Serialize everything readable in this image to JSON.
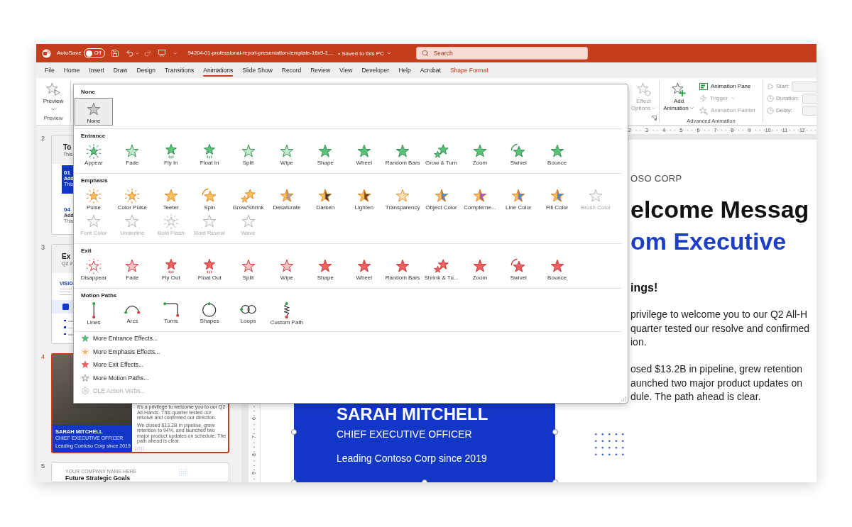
{
  "title_bar": {
    "autosave_label": "AutoSave",
    "autosave": {
      "label": "Off",
      "on": false
    },
    "file_name": "94204-01-professional-report-presentation-template-16x9-1....",
    "save_status": "• Saved to this PC",
    "search": {
      "placeholder": "Search"
    }
  },
  "tabs": [
    {
      "label": "File",
      "selected": false,
      "contextual": false
    },
    {
      "label": "Home",
      "selected": false,
      "contextual": false
    },
    {
      "label": "Insert",
      "selected": false,
      "contextual": false
    },
    {
      "label": "Draw",
      "selected": false,
      "contextual": false
    },
    {
      "label": "Design",
      "selected": false,
      "contextual": false
    },
    {
      "label": "Transitions",
      "selected": false,
      "contextual": false
    },
    {
      "label": "Animations",
      "selected": true,
      "contextual": false
    },
    {
      "label": "Slide Show",
      "selected": false,
      "contextual": false
    },
    {
      "label": "Record",
      "selected": false,
      "contextual": false
    },
    {
      "label": "Review",
      "selected": false,
      "contextual": false
    },
    {
      "label": "View",
      "selected": false,
      "contextual": false
    },
    {
      "label": "Developer",
      "selected": false,
      "contextual": false
    },
    {
      "label": "Help",
      "selected": false,
      "contextual": false
    },
    {
      "label": "Acrobat",
      "selected": false,
      "contextual": false
    },
    {
      "label": "Shape Format",
      "selected": false,
      "contextual": true
    }
  ],
  "ribbon": {
    "preview": {
      "label": "Preview",
      "group": "Preview"
    },
    "effect_options": {
      "label": "Effect Options",
      "disabled": true
    },
    "advanced_animation": {
      "add": {
        "label": "Add Animation"
      },
      "commands": [
        {
          "label": "Animation Pane",
          "kind": "pane",
          "disabled": false
        },
        {
          "label": "Trigger",
          "kind": "trigger",
          "disabled": true
        },
        {
          "label": "Animation Painter",
          "kind": "painter",
          "disabled": true
        }
      ],
      "group": "Advanced Animation"
    },
    "timing": [
      {
        "label": "Start:",
        "kind": "start",
        "disabled": true
      },
      {
        "label": "Duration:",
        "kind": "duration",
        "disabled": true
      },
      {
        "label": "Delay:",
        "kind": "delay",
        "disabled": true
      }
    ]
  },
  "animation_gallery": {
    "sections": [
      {
        "title": "None",
        "kind": "none",
        "items": [
          {
            "label": "None",
            "selected": true
          }
        ]
      },
      {
        "title": "Entrance",
        "kind": "entrance",
        "items": [
          {
            "label": "Appear",
            "selected": false
          },
          {
            "label": "Fade",
            "selected": false
          },
          {
            "label": "Fly In",
            "selected": false
          },
          {
            "label": "Float In",
            "selected": false
          },
          {
            "label": "Split",
            "selected": false
          },
          {
            "label": "Wipe",
            "selected": false
          },
          {
            "label": "Shape",
            "selected": false
          },
          {
            "label": "Wheel",
            "selected": false
          },
          {
            "label": "Random Bars",
            "selected": false
          },
          {
            "label": "Grow & Turn",
            "selected": false
          },
          {
            "label": "Zoom",
            "selected": false
          },
          {
            "label": "Swivel",
            "selected": false
          },
          {
            "label": "Bounce",
            "selected": false
          }
        ]
      },
      {
        "title": "Emphasis",
        "kind": "emphasis",
        "items": [
          {
            "label": "Pulse",
            "selected": false,
            "disabled": false
          },
          {
            "label": "Color Pulse",
            "selected": false,
            "disabled": false
          },
          {
            "label": "Teeter",
            "selected": false,
            "disabled": false
          },
          {
            "label": "Spin",
            "selected": false,
            "disabled": false
          },
          {
            "label": "Grow/Shrink",
            "selected": false,
            "disabled": false
          },
          {
            "label": "Desaturate",
            "selected": false,
            "disabled": false
          },
          {
            "label": "Darken",
            "selected": false,
            "disabled": false
          },
          {
            "label": "Lighten",
            "selected": false,
            "disabled": false
          },
          {
            "label": "Transparency",
            "selected": false,
            "disabled": false
          },
          {
            "label": "Object Color",
            "selected": false,
            "disabled": false
          },
          {
            "label": "Compleme...",
            "selected": false,
            "disabled": false
          },
          {
            "label": "Line Color",
            "selected": false,
            "disabled": false
          },
          {
            "label": "Fill Color",
            "selected": false,
            "disabled": false
          },
          {
            "label": "Brush Color",
            "selected": false,
            "disabled": true
          },
          {
            "label": "Font Color",
            "selected": false,
            "disabled": true
          },
          {
            "label": "Underline",
            "selected": false,
            "disabled": true
          },
          {
            "label": "Bold Flash",
            "selected": false,
            "disabled": true
          },
          {
            "label": "Bold Reveal",
            "selected": false,
            "disabled": true
          },
          {
            "label": "Wave",
            "selected": false,
            "disabled": true
          }
        ]
      },
      {
        "title": "Exit",
        "kind": "exit",
        "items": [
          {
            "label": "Disappear",
            "selected": false
          },
          {
            "label": "Fade",
            "selected": false
          },
          {
            "label": "Fly Out",
            "selected": false
          },
          {
            "label": "Float Out",
            "selected": false
          },
          {
            "label": "Split",
            "selected": false
          },
          {
            "label": "Wipe",
            "selected": false
          },
          {
            "label": "Shape",
            "selected": false
          },
          {
            "label": "Wheel",
            "selected": false
          },
          {
            "label": "Random Bars",
            "selected": false
          },
          {
            "label": "Shrink & Tu...",
            "selected": false
          },
          {
            "label": "Zoom",
            "selected": false
          },
          {
            "label": "Swivel",
            "selected": false
          },
          {
            "label": "Bounce",
            "selected": false
          }
        ]
      },
      {
        "title": "Motion Paths",
        "kind": "motion",
        "items": [
          {
            "label": "Lines",
            "kind": "line",
            "selected": false
          },
          {
            "label": "Arcs",
            "kind": "arc",
            "selected": false
          },
          {
            "label": "Turns",
            "kind": "turn",
            "selected": false
          },
          {
            "label": "Shapes",
            "kind": "shape",
            "selected": false
          },
          {
            "label": "Loops",
            "kind": "loop",
            "selected": false
          },
          {
            "label": "Custom Path",
            "kind": "custom",
            "selected": false
          }
        ]
      }
    ],
    "more": [
      {
        "label": "More Entrance Effects...",
        "kind": "entrance",
        "disabled": false
      },
      {
        "label": "More Emphasis Effects...",
        "kind": "emphasis",
        "disabled": false
      },
      {
        "label": "More Exit Effects...",
        "kind": "exit",
        "disabled": false
      },
      {
        "label": "More Motion Paths...",
        "kind": "motion",
        "disabled": false
      },
      {
        "label": "OLE Action Verbs...",
        "kind": "verbs",
        "disabled": true
      }
    ]
  },
  "thumbnails": [
    {
      "number": "2",
      "selected": false,
      "kind": "agenda",
      "title": "To",
      "subtitle": "This",
      "items": [
        {
          "number": "01",
          "label": "Add",
          "text": "This",
          "highlighted": true
        },
        {
          "number": "04",
          "label": "Add",
          "text": "This",
          "highlighted": false
        }
      ]
    },
    {
      "number": "3",
      "selected": false,
      "kind": "executive",
      "title": "Ex",
      "subtitle": "Q2 2",
      "label": "VISIO"
    },
    {
      "number": "4",
      "selected": true,
      "kind": "welcome",
      "name": "SARAH MITCHELL",
      "role": "CHIEF EXECUTIVE OFFICER",
      "tagline": "Leading Contoso Corp since 2019",
      "paragraphs": [
        "It's a privilege to welcome you to our Q2 All-Hands. This quarter tested our resolve and confirmed our direction.",
        "We closed $13.2B in pipeline, grew retention to 94%, and launched two major product updates on schedule. The path ahead is clear."
      ]
    },
    {
      "number": "5",
      "selected": false,
      "kind": "goals",
      "eyebrow": "YOUR COMPANY NAME HERE",
      "title": "Future Strategic Goals"
    }
  ],
  "ruler": {
    "horizontal": [
      "2",
      "3",
      "4",
      "5",
      "6",
      "7",
      "8",
      "9",
      "10",
      "11",
      "12"
    ],
    "vertical": [
      "6",
      "7",
      "8",
      "9"
    ]
  },
  "slide": {
    "company": "OSO CORP",
    "heading": "elcome Messag",
    "subheading": "om Executive",
    "greeting": "ings!",
    "paragraphs": [
      [
        "privilege to welcome you to our Q2 All-H",
        "quarter tested our resolve and confirmed",
        "ion."
      ],
      [
        "osed $13.2B in pipeline, grew retention",
        "aunched two major product updates on",
        "dule. The path ahead is clear."
      ]
    ],
    "card": {
      "name": "SARAH MITCHELL",
      "role": "CHIEF EXECUTIVE OFFICER",
      "tagline": "Leading Contoso Corp since 2019",
      "selected": true
    }
  }
}
